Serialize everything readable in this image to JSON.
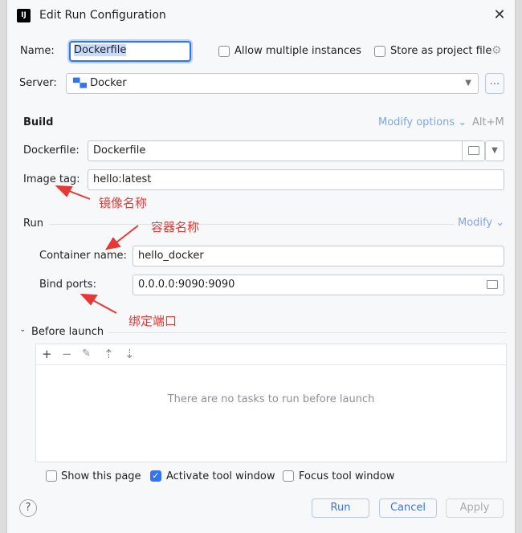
{
  "window": {
    "title": "Edit Run Configuration",
    "app_icon": "IJ"
  },
  "name": {
    "label": "Name:",
    "value": "Dockerfile"
  },
  "options": {
    "allow_multiple": "Allow multiple instances",
    "store_project": "Store as project file"
  },
  "server": {
    "label": "Server:",
    "value": "Docker",
    "more": "..."
  },
  "build": {
    "heading": "Build",
    "modify": "Modify options",
    "shortcut": "Alt+M",
    "dockerfile_label": "Dockerfile:",
    "dockerfile_value": "Dockerfile",
    "image_tag_label": "Image tag:",
    "image_tag_value": "hello:latest"
  },
  "run": {
    "heading": "Run",
    "modify": "Modify",
    "container_label": "Container name:",
    "container_value": "hello_docker",
    "ports_label": "Bind ports:",
    "ports_value": "0.0.0.0:9090:9090"
  },
  "annotations": {
    "image_name": "镜像名称",
    "container_name": "容器名称",
    "bind_ports": "绑定端口"
  },
  "before_launch": {
    "heading": "Before launch",
    "empty": "There are no tasks to run before launch"
  },
  "footer_options": {
    "show_page": "Show this page",
    "activate": "Activate tool window",
    "focus": "Focus tool window"
  },
  "buttons": {
    "help": "?",
    "run": "Run",
    "cancel": "Cancel",
    "apply": "Apply"
  },
  "colors": {
    "accent": "#3574f0",
    "annotation": "#e53935",
    "link": "#7fa6e6"
  }
}
